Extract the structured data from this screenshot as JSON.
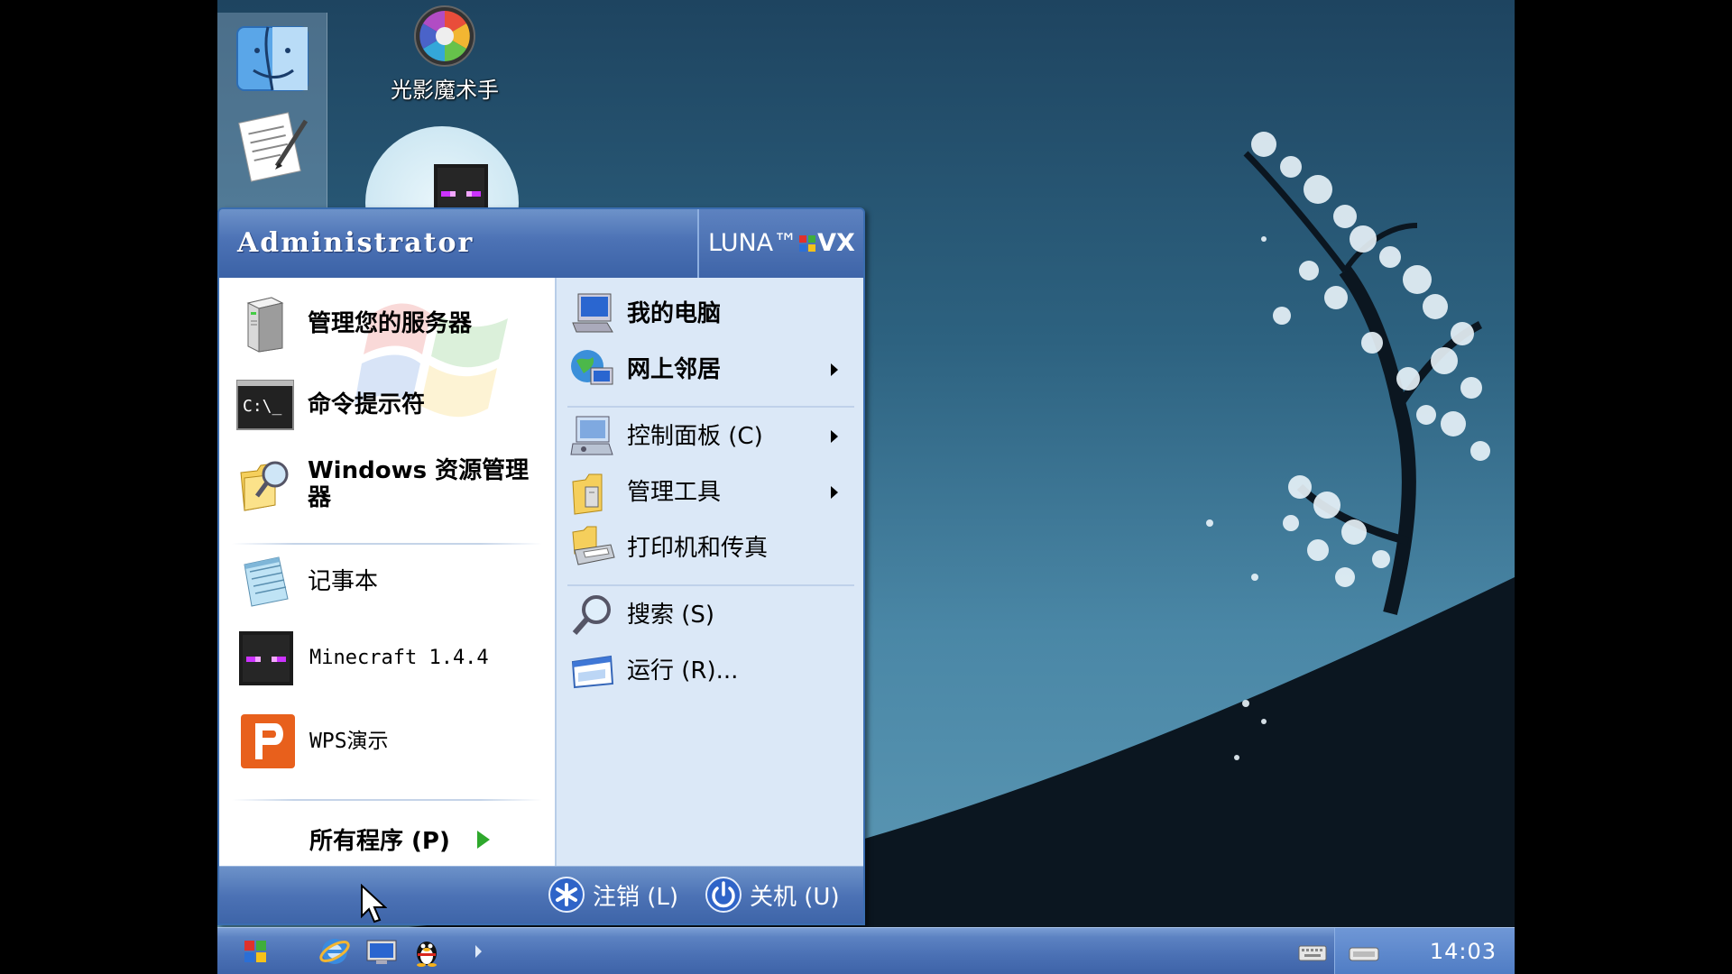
{
  "desktop": {
    "icons": [
      {
        "label": "光影魔术手"
      }
    ]
  },
  "start_menu": {
    "user_name": "Administrator",
    "brand": {
      "prefix": "LUNA™",
      "suffix": "VX"
    },
    "pinned": [
      {
        "label": "管理您的服务器"
      },
      {
        "label": "命令提示符"
      },
      {
        "label": "Windows 资源管理器"
      }
    ],
    "recent": [
      {
        "label": "记事本"
      },
      {
        "label": "Minecraft 1.4.4"
      },
      {
        "label": "WPS演示"
      }
    ],
    "all_programs": "所有程序 (P)",
    "right": [
      {
        "label": "我的电脑"
      },
      {
        "label": "网上邻居"
      },
      {
        "label": "控制面板 (C)"
      },
      {
        "label": "管理工具"
      },
      {
        "label": "打印机和传真"
      },
      {
        "label": "搜索 (S)"
      },
      {
        "label": "运行 (R)..."
      }
    ],
    "footer": {
      "logoff": "注销 (L)",
      "shutdown": "关机 (U)"
    }
  },
  "taskbar": {
    "clock": "14:03"
  },
  "colors": {
    "menu_blue": "#4c72b5",
    "right_panel": "#dbe8f7",
    "taskbar": "#4a70b4"
  }
}
